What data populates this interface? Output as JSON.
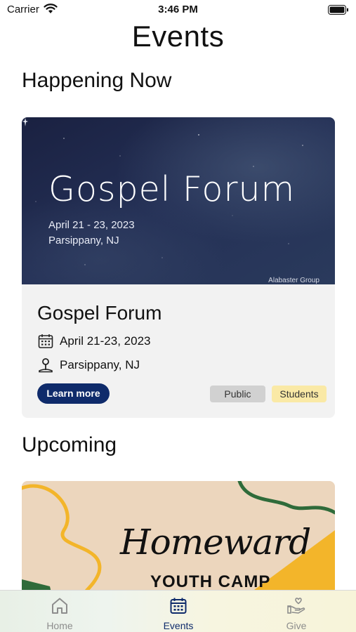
{
  "status_bar": {
    "carrier": "Carrier",
    "time": "3:46 PM"
  },
  "page_title": "Events",
  "sections": {
    "happening_now": "Happening Now",
    "upcoming": "Upcoming"
  },
  "featured_event": {
    "banner": {
      "title": "Gospel Forum",
      "date": "April 21 - 23, 2023",
      "location": "Parsippany, NJ",
      "brand": "Alabaster Group"
    },
    "title": "Gospel Forum",
    "date": "April 21-23, 2023",
    "location": "Parsippany, NJ",
    "button_label": "Learn more",
    "tags": [
      "Public",
      "Students"
    ],
    "colors": {
      "banner": "#1f2745",
      "button": "#0f2b6b",
      "tag_public": "#d1d1d1",
      "tag_students": "#fae9a6"
    }
  },
  "upcoming_event": {
    "banner_script": "Homeward",
    "banner_subtitle": "YOUTH CAMP",
    "colors": {
      "background": "#ecd6bd",
      "accent_yellow": "#f3b52a",
      "accent_green": "#2f6b3a"
    }
  },
  "tab_bar": {
    "items": [
      {
        "label": "Home",
        "icon": "home-icon",
        "active": false
      },
      {
        "label": "Events",
        "icon": "calendar-icon",
        "active": true
      },
      {
        "label": "Give",
        "icon": "give-icon",
        "active": false
      }
    ],
    "active_color": "#0f2b6b",
    "inactive_color": "#8d8d8d"
  }
}
